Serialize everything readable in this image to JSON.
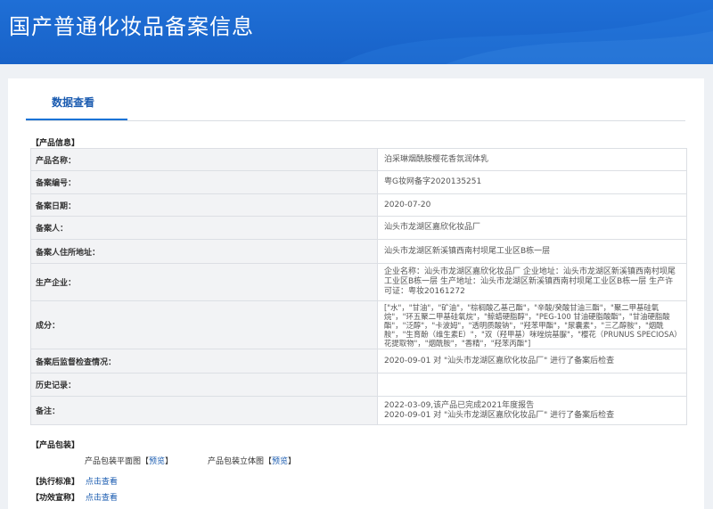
{
  "header": {
    "title": "国产普通化妆品备案信息"
  },
  "tabs": [
    {
      "label": "数据查看"
    }
  ],
  "product_info": {
    "section_title": "【产品信息】",
    "rows": [
      {
        "label": "产品名称：",
        "value": "泊采琳烟酰胺樱花香氛润体乳"
      },
      {
        "label": "备案编号：",
        "value": "粤G妆网备字2020135251"
      },
      {
        "label": "备案日期：",
        "value": "2020-07-20"
      },
      {
        "label": "备案人：",
        "value": "汕头市龙湖区嘉欣化妆品厂"
      },
      {
        "label": "备案人住所地址：",
        "value": "汕头市龙湖区新溪镇西南村坝尾工业区B栋一层"
      },
      {
        "label": "生产企业：",
        "value": "企业名称：汕头市龙湖区嘉欣化妆品厂 企业地址：汕头市龙湖区新溪镇西南村坝尾工业区B栋一层 生产地址：汕头市龙湖区新溪镇西南村坝尾工业区B栋一层 生产许可证：粤妆20161272"
      },
      {
        "label": "成分：",
        "value": "[\"水\"，\"甘油\"，\"矿油\"，\"棕榈酸乙基己酯\"，\"辛酸/癸酸甘油三酯\"，\"聚二甲基硅氧烷\"，\"环五聚二甲基硅氧烷\"，\"鲸蜡硬脂醇\"，\"PEG-100 甘油硬脂酸酯\"，\"甘油硬脂酸酯\"，\"泛醇\"，\"卡波姆\"，\"透明质酸钠\"，\"羟苯甲酯\"，\"尿囊素\"，\"三乙醇胺\"，\"烟酰胺\"，\"生育酚（维生素E）\"，\"双（羟甲基）咪唑烷基脲\"，\"樱花（PRUNUS SPECIOSA）花提取物\"，\"烟酰胺\"，\"香精\"，\"羟苯丙酯\"]"
      },
      {
        "label": "备案后监督检查情况：",
        "value": "2020-09-01 对 \"汕头市龙湖区嘉欣化妆品厂\" 进行了备案后检查"
      },
      {
        "label": "历史记录：",
        "value": ""
      },
      {
        "label": "备注：",
        "value_lines": [
          "2022-03-09,该产品已完成2021年度报告",
          "2020-09-01 对 \"汕头市龙湖区嘉欣化妆品厂\" 进行了备案后检查"
        ]
      }
    ]
  },
  "packaging": {
    "section_title": "【产品包装】",
    "items": [
      {
        "label": "产品包装平面图",
        "bracket_open": "【",
        "link": "预览",
        "bracket_close": "】"
      },
      {
        "label": "产品包装立体图",
        "bracket_open": "【",
        "link": "预览",
        "bracket_close": "】"
      }
    ]
  },
  "standards": {
    "label": "【执行标准】",
    "link": "点击查看"
  },
  "claims": {
    "label": "【功效宣称】",
    "link": "点击查看"
  }
}
